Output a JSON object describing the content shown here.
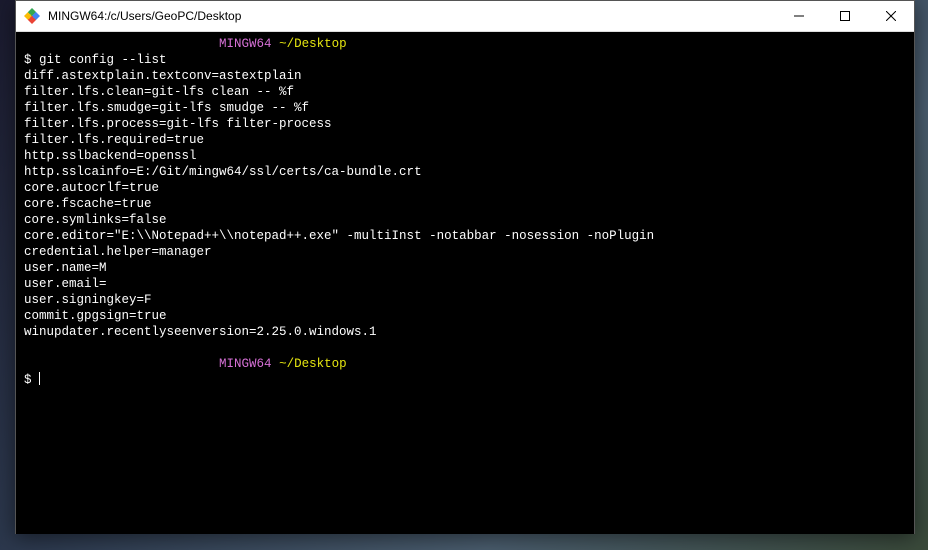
{
  "window": {
    "title": "MINGW64:/c/Users/GeoPC/Desktop"
  },
  "terminal": {
    "prompt1": {
      "env": "MINGW64",
      "path": "~/Desktop"
    },
    "command1": "git config --list",
    "output_lines": [
      "diff.astextplain.textconv=astextplain",
      "filter.lfs.clean=git-lfs clean -- %f",
      "filter.lfs.smudge=git-lfs smudge -- %f",
      "filter.lfs.process=git-lfs filter-process",
      "filter.lfs.required=true",
      "http.sslbackend=openssl",
      "http.sslcainfo=E:/Git/mingw64/ssl/certs/ca-bundle.crt",
      "core.autocrlf=true",
      "core.fscache=true",
      "core.symlinks=false",
      "core.editor=\"E:\\\\Notepad++\\\\notepad++.exe\" -multiInst -notabbar -nosession -noPlugin",
      "credential.helper=manager",
      "user.name=M",
      "user.email=",
      "user.signingkey=F",
      "commit.gpgsign=true",
      "winupdater.recentlyseenversion=2.25.0.windows.1"
    ],
    "prompt2": {
      "env": "MINGW64",
      "path": "~/Desktop"
    },
    "dollar": "$",
    "dollar_cmd": "$ "
  }
}
